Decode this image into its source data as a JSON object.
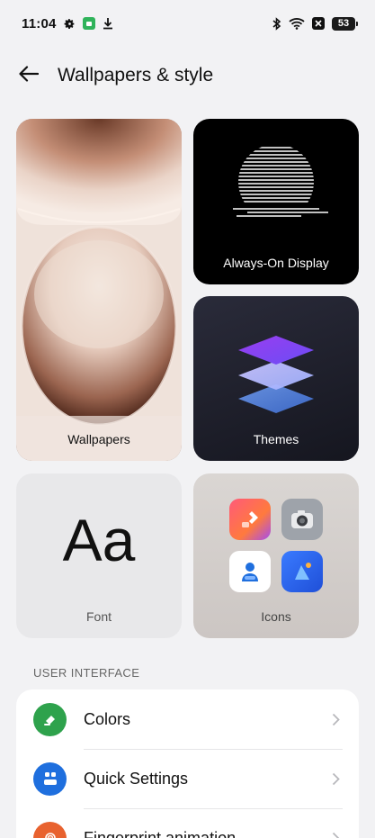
{
  "status_bar": {
    "time": "11:04",
    "battery": "53",
    "left_icons": [
      "gear-icon",
      "app-notification-icon",
      "download-icon"
    ],
    "right_icons": [
      "bluetooth-icon",
      "wifi-icon",
      "x-notification-icon",
      "battery-icon"
    ]
  },
  "header": {
    "title": "Wallpapers & style",
    "back_icon": "arrow-left-icon"
  },
  "tiles": {
    "wallpapers": {
      "label": "Wallpapers"
    },
    "always_on_display": {
      "label": "Always-On Display"
    },
    "themes": {
      "label": "Themes"
    },
    "font": {
      "label": "Font",
      "sample": "Aa"
    },
    "icons": {
      "label": "Icons"
    }
  },
  "user_interface": {
    "header": "USER INTERFACE",
    "items": [
      {
        "label": "Colors",
        "icon": "paint-bucket-icon",
        "color": "#2ea24c"
      },
      {
        "label": "Quick Settings",
        "icon": "quick-settings-icon",
        "color": "#1f6fde"
      },
      {
        "label": "Fingerprint animation",
        "icon": "fingerprint-icon",
        "color": "#e8622f"
      }
    ]
  },
  "colors": {
    "background": "#f2f2f4",
    "card": "#ffffff"
  }
}
